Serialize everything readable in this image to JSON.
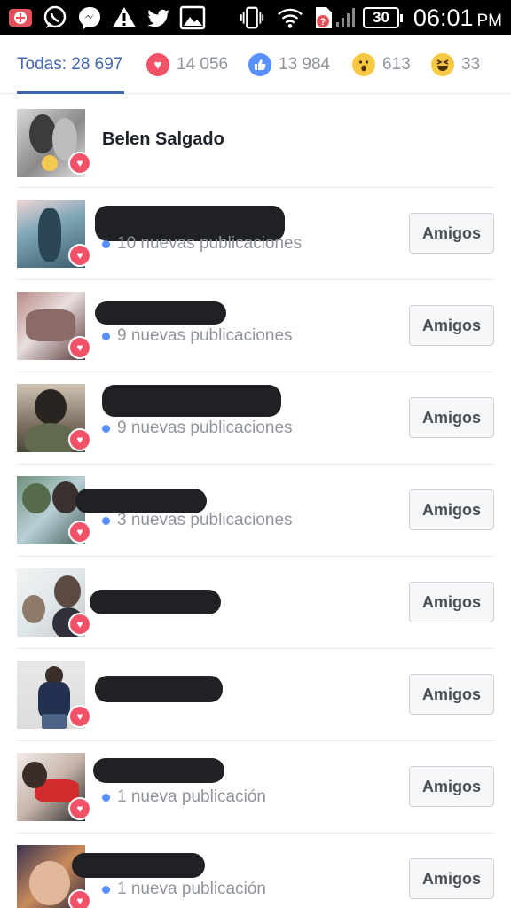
{
  "status_bar": {
    "battery": "30",
    "time": "06:01",
    "ampm": "PM",
    "icons": [
      "add-app-icon",
      "whatsapp-icon",
      "messenger-icon",
      "warning-icon",
      "twitter-icon",
      "gallery-icon",
      "vibrate-icon",
      "wifi-icon",
      "sim-error-icon",
      "signal-icon"
    ]
  },
  "tabs": {
    "all": "Todas: 28 697",
    "love": "14 056",
    "like": "13 984",
    "wow": "613",
    "haha": "33"
  },
  "list": [
    {
      "name": "Belen Salgado",
      "subtitle": "",
      "button": ""
    },
    {
      "name": "",
      "subtitle": "10 nuevas publicaciones",
      "button": "Amigos"
    },
    {
      "name": "",
      "subtitle": "9 nuevas publicaciones",
      "button": "Amigos"
    },
    {
      "name": "",
      "subtitle": "9 nuevas publicaciones",
      "button": "Amigos"
    },
    {
      "name": "",
      "subtitle": "3 nuevas publicaciones",
      "button": "Amigos"
    },
    {
      "name": "",
      "subtitle": "",
      "button": "Amigos"
    },
    {
      "name": "",
      "subtitle": "",
      "button": "Amigos"
    },
    {
      "name": "",
      "subtitle": "1 nueva publicación",
      "button": "Amigos"
    },
    {
      "name": "",
      "subtitle": "1 nueva publicación",
      "button": "Amigos"
    }
  ],
  "colors": {
    "accent": "#4267b2",
    "love": "#f25268",
    "like": "#5890ff",
    "emoji": "#f7c843"
  }
}
